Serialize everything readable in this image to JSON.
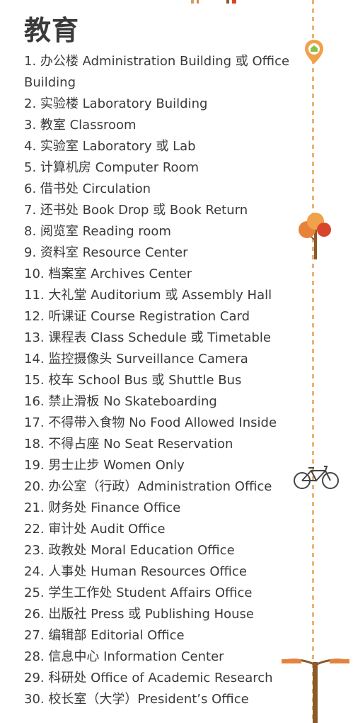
{
  "title": "教育",
  "items": [
    "1. 办公楼 Administration Building 或 Office Building",
    "2. 实验楼 Laboratory Building",
    "3. 教室 Classroom",
    "4. 实验室 Laboratory 或 Lab",
    "5. 计算机房 Computer Room",
    "6. 借书处 Circulation",
    "7. 还书处 Book Drop 或 Book Return",
    "8. 阅览室 Reading room",
    "9. 资料室 Resource Center",
    "10. 档案室 Archives Center",
    "11. 大礼堂 Auditorium 或 Assembly Hall",
    "12. 听课证 Course Registration Card",
    "13. 课程表 Class Schedule 或 Timetable",
    "14. 监控摄像头 Surveillance Camera",
    "15. 校车 School Bus 或 Shuttle Bus",
    "16. 禁止滑板 No Skateboarding",
    "17. 不得带入食物 No Food Allowed Inside",
    "18. 不得占座 No Seat Reservation",
    "19. 男士止步 Women Only",
    "20. 办公室（行政）Administration Office",
    "21. 财务处 Finance Office",
    "22. 审计处 Audit Office",
    "23. 政教处 Moral Education Office",
    "24. 人事处 Human Resources Office",
    "25. 学生工作处 Student Affairs Office",
    "26. 出版社 Press 或 Publishing House",
    "27. 编辑部 Editorial Office",
    "28. 信息中心 Information Center",
    "29. 科研处 Office of Academic Research",
    "30. 校长室（大学）President’s Office"
  ],
  "colors": {
    "text": "#3a3a3a",
    "accent_orange": "#e8823a",
    "accent_red": "#d9452b",
    "trunk_brown": "#8a5a2b",
    "road_dash": "#e9b27a"
  },
  "icons": [
    "location-pin-icon",
    "tree-icon",
    "bicycle-icon",
    "street-lamp-icon"
  ]
}
